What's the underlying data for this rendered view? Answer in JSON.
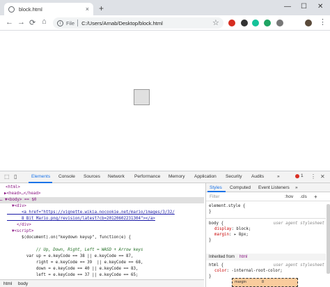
{
  "browser": {
    "tab_title": "block.html",
    "tab_close": "×",
    "new_tab": "+",
    "window_controls": [
      "—",
      "☐",
      "✕"
    ],
    "nav": {
      "back": "←",
      "forward": "→",
      "reload": "⟳"
    },
    "omnibox": {
      "info": "i",
      "scheme": "File",
      "url": "C:/Users/Arnab/Desktop/block.html"
    },
    "star": "☆"
  },
  "devtools": {
    "tabs": [
      "Elements",
      "Console",
      "Sources",
      "Network",
      "Performance",
      "Memory",
      "Application",
      "Security",
      "Audits"
    ],
    "more": "»",
    "error_count": "1",
    "menu": "⋮",
    "close": "✕",
    "elements": {
      "lines": [
        {
          "t": "<html>"
        },
        {
          "t": "▶<head>…</head>"
        },
        {
          "t": "… ▼<body> == $0"
        },
        {
          "t": "  ▼<div>"
        },
        {
          "t": "      <a href=\"https://vignette.wikia.nocookie.net/mario/images/3/32/"
        },
        {
          "t": "      8_Bit_Mario.png/revision/latest?cb=20120602231304\"></a>"
        },
        {
          "t": "    </div>"
        },
        {
          "t": "  ▼<script>"
        },
        {
          "t": "      $(document).on(\"keydown keyup\", function(e) {"
        },
        {
          "t": ""
        },
        {
          "t": "            // Up, Down, Right, Left = WASD + Arrow keys"
        },
        {
          "t": "        var up = e.keyCode == 38 || e.keyCode == 87,"
        },
        {
          "t": "            right = e.keyCode == 39  || e.keyCode == 68,"
        },
        {
          "t": "            down = e.keyCode == 40 || e.keyCode == 83,"
        },
        {
          "t": "            left = e.keyCode == 37 || e.keyCode == 65;"
        }
      ],
      "breadcrumb": [
        "html",
        "body"
      ]
    },
    "styles": {
      "tabs": [
        "Styles",
        "Computed",
        "Event Listeners"
      ],
      "more": "»",
      "filter_placeholder": "Filter",
      "hov": ":hov",
      "cls": ".cls",
      "add": "+",
      "element_style": [
        "element.style {",
        "}"
      ],
      "body_rule": {
        "selector": "body {",
        "source": "user agent stylesheet",
        "props": [
          {
            "name": "display",
            "value": "block;"
          },
          {
            "name": "margin",
            "value": "▸ 8px;"
          }
        ],
        "close": "}"
      },
      "inherited_label": "Inherited from",
      "inherited_tag": "html",
      "html_rule": {
        "selector": "html {",
        "source": "user agent stylesheet",
        "props": [
          {
            "name": "color",
            "value": "-internal-root-color;"
          }
        ],
        "close": "}"
      },
      "box_model": {
        "label": "margin",
        "value": "8"
      }
    }
  }
}
